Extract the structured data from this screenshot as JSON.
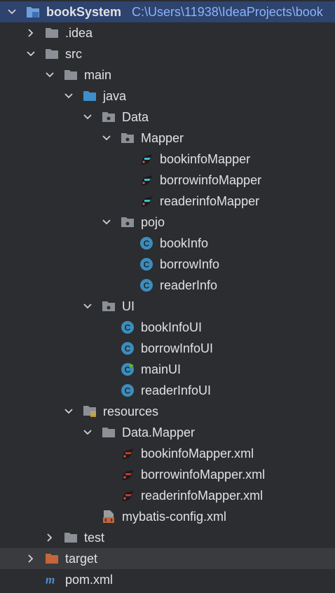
{
  "project": {
    "name": "bookSystem",
    "path": "C:\\Users\\11938\\IdeaProjects\\book"
  },
  "nodes": {
    "idea": ".idea",
    "src": "src",
    "main": "main",
    "java": "java",
    "data": "Data",
    "mapper": "Mapper",
    "bookinfoMapper": "bookinfoMapper",
    "borrowinfoMapper": "borrowinfoMapper",
    "readerinfoMapper": "readerinfoMapper",
    "pojo": "pojo",
    "bookInfo": "bookInfo",
    "borrowInfo": "borrowInfo",
    "readerInfo": "readerInfo",
    "ui": "UI",
    "bookInfoUI": "bookInfoUI",
    "borrowInfoUI": "borrowInfoUI",
    "mainUI": "mainUI",
    "readerInfoUI": "readerInfoUI",
    "resources": "resources",
    "dataMapper": "Data.Mapper",
    "bookinfoMapperXml": "bookinfoMapper.xml",
    "borrowinfoMapperXml": "borrowinfoMapper.xml",
    "readerinfoMapperXml": "readerinfoMapper.xml",
    "mybatisConfig": "mybatis-config.xml",
    "test": "test",
    "target": "target",
    "pom": "pom.xml"
  },
  "colors": {
    "background": "#2b2d30",
    "selection": "#2e436e",
    "folder": "#8c9096",
    "source_folder": "#3d8ec9",
    "excluded_folder": "#c4663b",
    "class_icon": "#3c8dbc",
    "text": "#dfe1e5",
    "path_text": "#8ab4f8"
  }
}
